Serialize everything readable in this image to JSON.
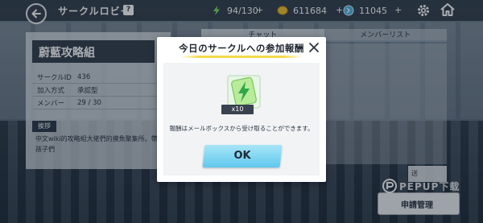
{
  "header": {
    "title": "サークルロビー",
    "help_badge": "?",
    "stamina": "94/130",
    "coins": "611684",
    "gems": "11045",
    "back_icon": "back-arrow-icon",
    "settings_icon": "gear-icon",
    "home_icon": "home-icon"
  },
  "circle": {
    "name": "蔚藍攻略組",
    "rows": [
      {
        "key": "サークルID",
        "value": "436"
      },
      {
        "key": "加入方式",
        "value": "承認型"
      },
      {
        "key": "メンバー",
        "value": "29 / 30"
      }
    ],
    "greeting_label": "挨拶",
    "greeting_text": "中文wiki的攻略組大佬們的摸魚聚集所。帶 孩子們"
  },
  "tabs": [
    "チャット",
    "メンバーリスト"
  ],
  "send_label": "送",
  "apply_button": "申請管理",
  "watermark": "PEPUP下载",
  "modal": {
    "title": "今日のサークルへの参加報酬",
    "reward_quantity": "x10",
    "note": "報酬はメールボックスから受け取ることができます。",
    "ok_label": "OK",
    "accent_color": "#f4d94a",
    "button_color": "#61c8ee"
  }
}
